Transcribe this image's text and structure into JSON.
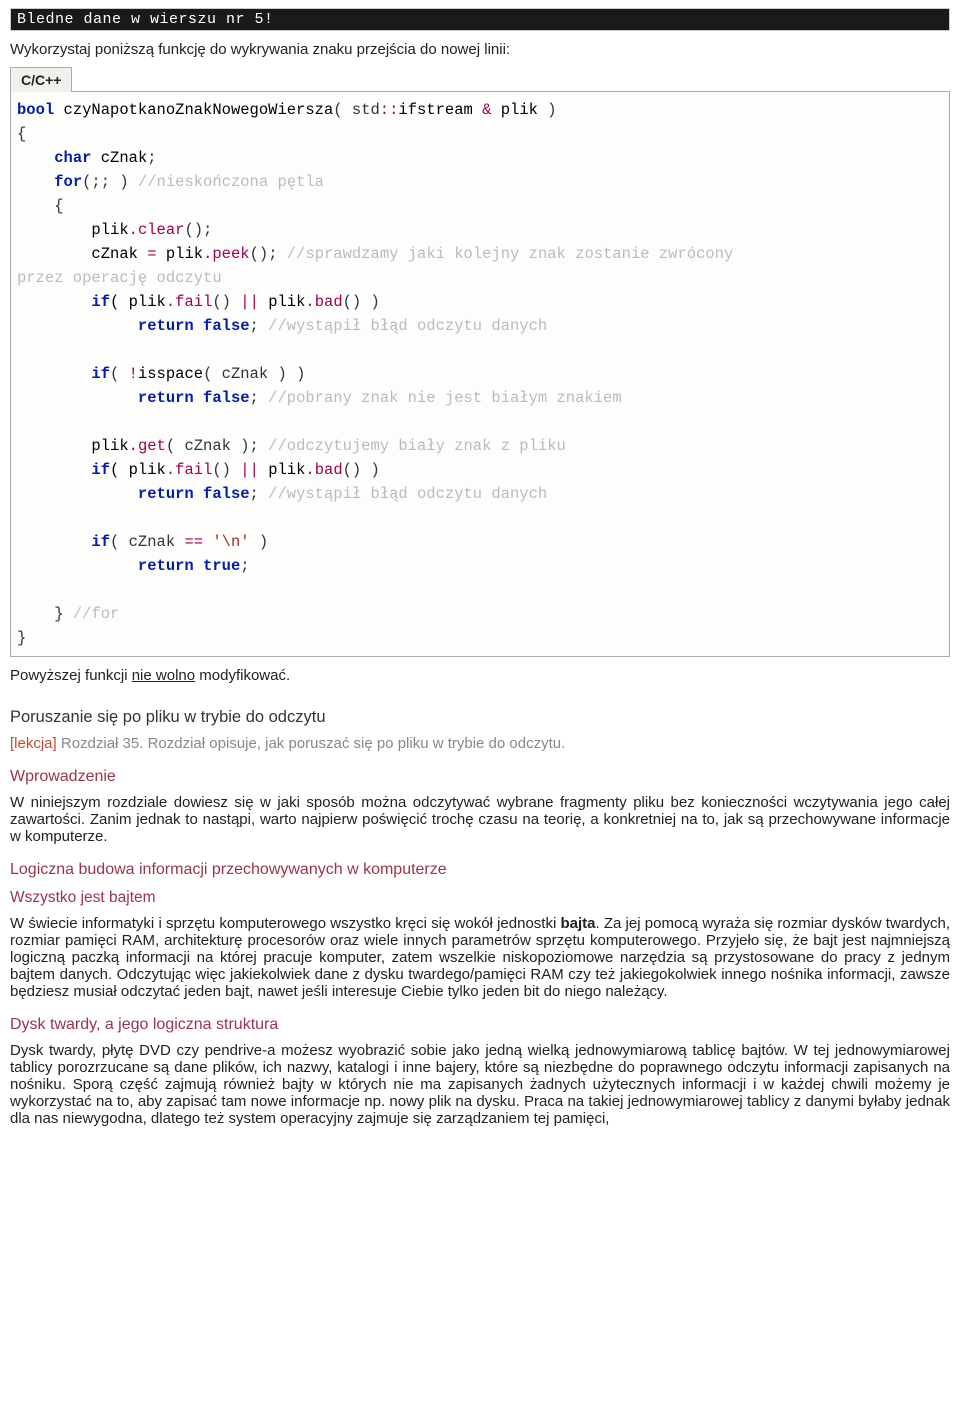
{
  "error_bar": "Bledne dane w wierszu nr 5!",
  "intro": "Wykorzystaj poniższą funkcję do wykrywania znaku przejścia do nowej linii:",
  "code_lang": "C/C++",
  "after_func_pre": "Powyższej funkcji ",
  "after_func_u": "nie wolno",
  "after_func_post": " modyfikować.",
  "section_nav_title": "Poruszanie się po pliku w trybie do odczytu",
  "lesson_tag": "[lekcja]",
  "lesson_desc": " Rozdział 35. Rozdział opisuje, jak poruszać się po pliku w trybie do odczytu.",
  "h_wprowadzenie": "Wprowadzenie",
  "p_wprowadzenie": "W niniejszym rozdziale dowiesz się w jaki sposób można odczytywać wybrane fragmenty pliku bez konieczności wczytywania jego całej zawartości. Zanim jednak to nastąpi, warto najpierw poświęcić trochę czasu na teorię, a konkretniej na to, jak są przechowywane informacje w komputerze.",
  "h_logiczna": "Logiczna budowa informacji przechowywanych w komputerze",
  "h_bajt": "Wszystko jest bajtem",
  "p_bajt_pre": "W świecie informatyki i sprzętu komputerowego wszystko kręci się wokół jednostki ",
  "p_bajt_bold": "bajta",
  "p_bajt_post": ". Za jej pomocą wyraża się rozmiar dysków twardych, rozmiar pamięci RAM, architekturę procesorów oraz wiele innych parametrów sprzętu komputerowego. Przyjeło się, że bajt jest najmniejszą logiczną paczką informacji na której pracuje komputer, zatem wszelkie niskopoziomowe narzędzia są przystosowane do pracy z jednym bajtem danych. Odczytując więc jakiekolwiek dane z dysku twardego/pamięci RAM czy też jakiegokolwiek innego nośnika informacji, zawsze będziesz musiał odczytać jeden bajt, nawet jeśli interesuje Ciebie tylko jeden bit do niego należący.",
  "h_dysk": "Dysk twardy, a jego logiczna struktura",
  "p_dysk": "Dysk twardy, płytę DVD czy pendrive-a możesz wyobrazić sobie jako jedną wielką jednowymiarową tablicę bajtów. W tej jednowymiarowej tablicy porozrzucane są dane plików, ich nazwy, katalogi i inne bajery, które są niezbędne do poprawnego odczytu informacji zapisanych na nośniku. Sporą część zajmują również bajty w których nie ma zapisanych żadnych użytecznych informacji i w każdej chwili możemy je wykorzystać na to, aby zapisać tam nowe informacje np. nowy plik na dysku. Praca na takiej jednowymiarowej tablicy z danymi byłaby jednak dla nas niewygodna, dlatego też system operacyjny zajmuje się zarządzaniem tej pamięci,",
  "code": {
    "l1_bool": "bool",
    "l1_fn": " czyNapotkanoZnakNowegoWiersza",
    "l1_par1": "( std",
    "l1_dcolon": "::",
    "l1_ifstream": "ifstream ",
    "l1_amp": "&",
    "l1_plik": " plik ",
    "l1_par2": ")",
    "l2_brace": "{",
    "l3_indent": "    ",
    "l3_char": "char",
    "l3_var": " cZnak",
    "l3_semi": ";",
    "l4_for": "for",
    "l4_args": "(;; )",
    "l4_comment": " //nieskończona pętla",
    "l5_brace": "    {",
    "l6_indent": "        plik",
    "l6_dot": ".",
    "l6_clear": "clear",
    "l6_end": "();",
    "l7_pre": "        cZnak ",
    "l7_eq": "=",
    "l7_mid": " plik",
    "l7_peek": "peek",
    "l7_end": "();",
    "l7_comment": " //sprawdzamy jaki kolejny znak zostanie zwrócony\nprzez operację odczytu",
    "l8_if": "if",
    "l8_open": "( plik",
    "l8_fail": "fail",
    "l8_mid": "() ",
    "l8_or": "||",
    "l8_plik2": " plik",
    "l8_bad": "bad",
    "l8_close": "() )",
    "l9_return": "return",
    "l9_false": " false",
    "l9_semi": ";",
    "l9_comment": " //wystąpił błąd odczytu danych",
    "l10_open": "( ",
    "l10_not": "!",
    "l10_isspace": "isspace",
    "l10_args": "( cZnak ) )",
    "l11_comment": " //pobrany znak nie jest białym znakiem",
    "l12_pre": "        plik",
    "l12_get": "get",
    "l12_args": "( cZnak );",
    "l12_comment": " //odczytujemy biały znak z pliku",
    "l14_open": "( cZnak ",
    "l14_eqeq": "==",
    "l14_str": " '\\n'",
    "l14_close": " )",
    "l15_true": " true",
    "l16_brace": "    }",
    "l16_comment": " //for",
    "l17_brace": "}"
  }
}
